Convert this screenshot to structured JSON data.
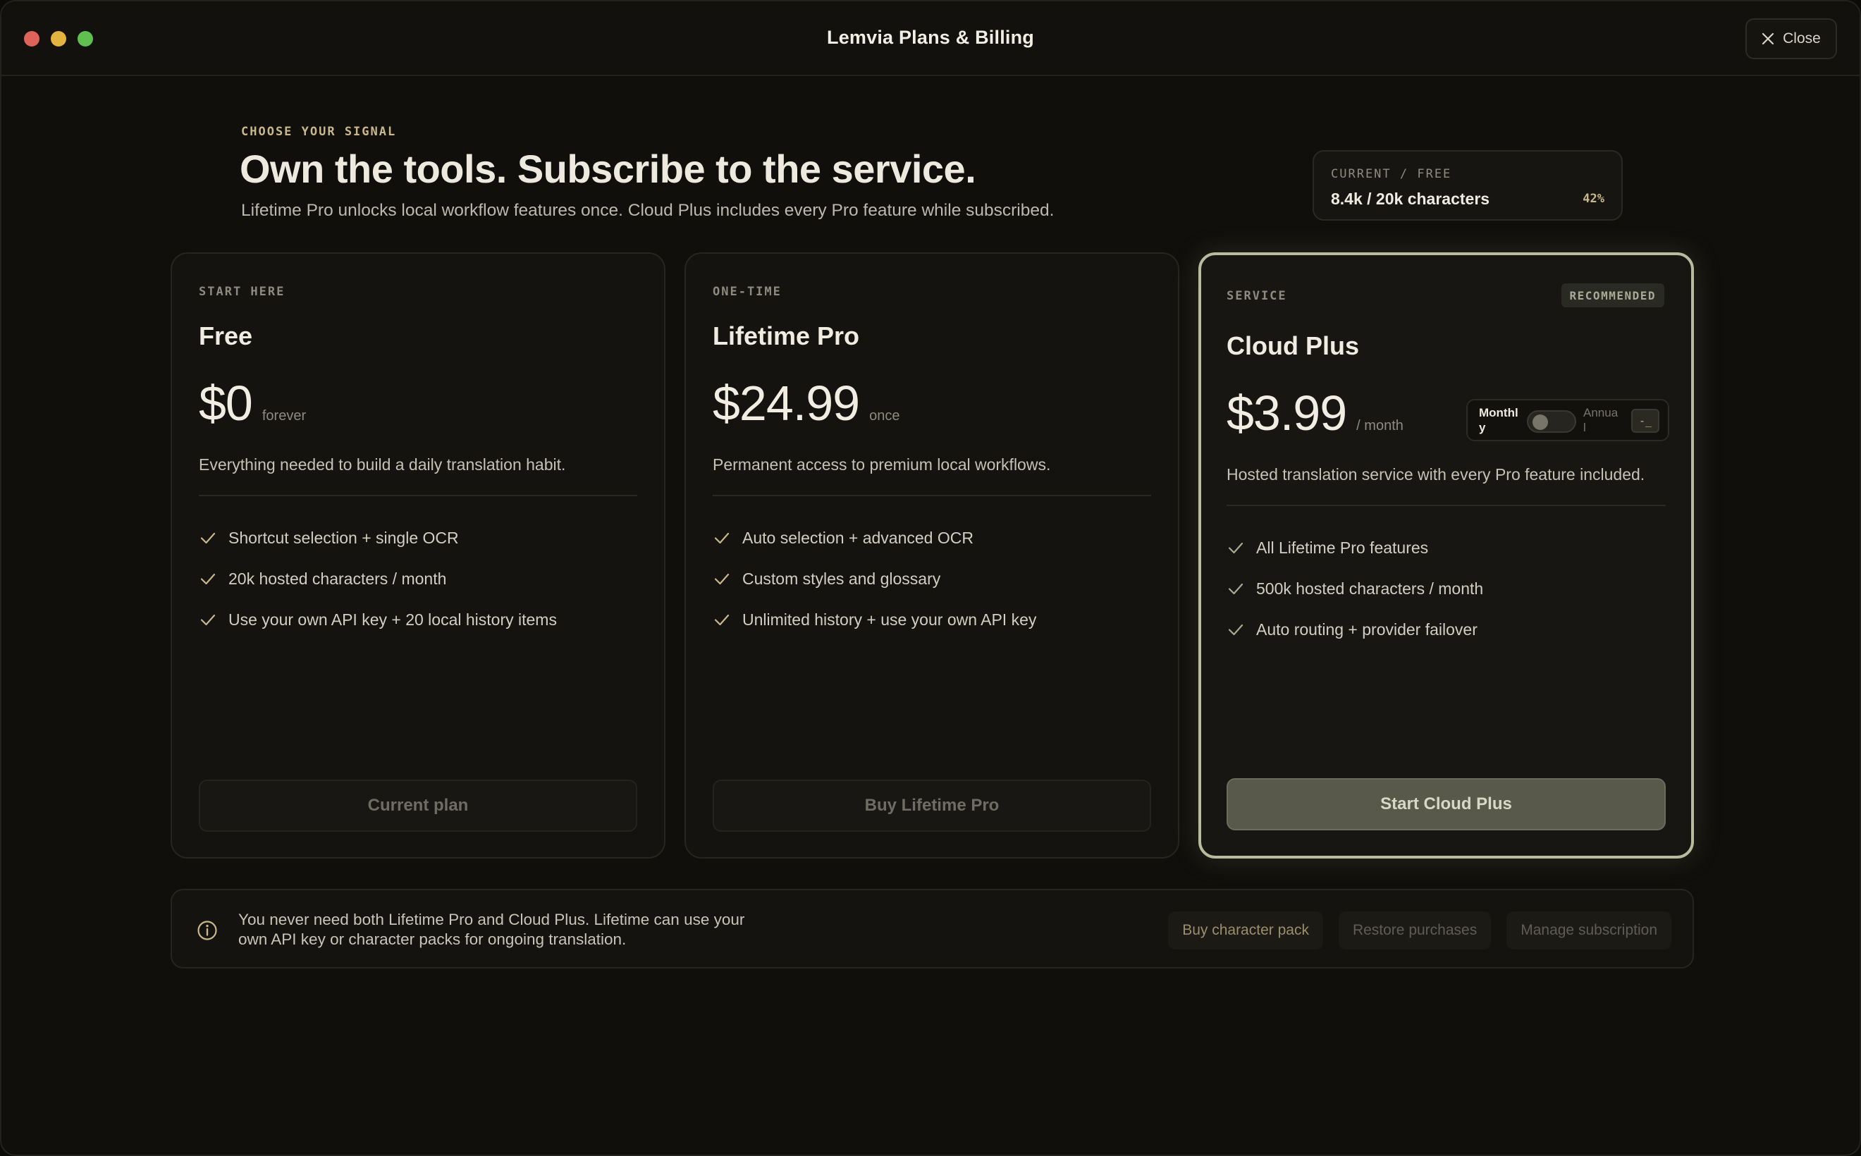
{
  "window": {
    "title": "Lemvia Plans & Billing",
    "close_label": "Close"
  },
  "header": {
    "eyebrow": "CHOOSE YOUR SIGNAL",
    "headline": "Own the tools. Subscribe to the service.",
    "subline": "Lifetime Pro unlocks local workflow features once. Cloud Plus includes every Pro feature while subscribed."
  },
  "usage": {
    "label": "CURRENT / FREE",
    "value": "8.4k / 20k characters",
    "percent": "42%",
    "fraction": 0.42
  },
  "plans": [
    {
      "eyebrow": "START HERE",
      "name": "Free",
      "price": "$0",
      "period": "forever",
      "description": "Everything needed to build a daily translation habit.",
      "features": [
        "Shortcut selection + single OCR",
        "20k hosted characters / month",
        "Use your own API key + 20 local history items"
      ],
      "button": "Current plan"
    },
    {
      "eyebrow": "ONE-TIME",
      "name": "Lifetime Pro",
      "price": "$24.99",
      "period": "once",
      "description": "Permanent access to premium local workflows.",
      "features": [
        "Auto selection + advanced OCR",
        "Custom styles and glossary",
        "Unlimited history + use your own API key"
      ],
      "button": "Buy Lifetime Pro"
    },
    {
      "eyebrow": "SERVICE",
      "badge": "RECOMMENDED",
      "name": "Cloud Plus",
      "price": "$3.99",
      "period": "/ month",
      "description": "Hosted translation service with every Pro feature included.",
      "features": [
        "All Lifetime Pro features",
        "500k hosted characters / month",
        "Auto routing + provider failover"
      ],
      "button": "Start Cloud Plus",
      "billing_toggle": {
        "left_label": "Monthly",
        "right_label": "Annual",
        "selected": "Monthly",
        "chip": "-_"
      }
    }
  ],
  "footer": {
    "note": "You never need both Lifetime Pro and Cloud Plus. Lifetime can use your own API key or character packs for ongoing translation.",
    "actions": {
      "buy_pack": "Buy character pack",
      "restore": "Restore purchases",
      "manage": "Manage subscription"
    }
  },
  "colors": {
    "accent": "#c9b88a",
    "check": "#c9b88a",
    "highlight_border": "#b9bb9f",
    "primary_button": "#58594a"
  },
  "icons": {
    "close": "x-icon",
    "check": "checkmark-icon",
    "info": "info-circle-icon"
  }
}
